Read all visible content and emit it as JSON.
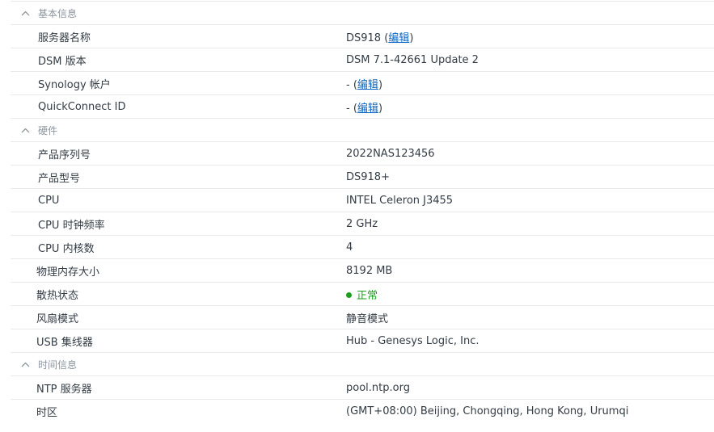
{
  "colors": {
    "link": "#0c66c2",
    "status_ok": "#1aa01a"
  },
  "sections": {
    "basic": {
      "title": "基本信息",
      "icon": "chevron-up-icon",
      "rows": {
        "server_name": {
          "label": "服务器名称",
          "value": "DS918",
          "edit": "编辑"
        },
        "dsm_version": {
          "label": "DSM 版本",
          "value": "DSM 7.1-42661 Update 2"
        },
        "synology_account": {
          "label": "Synology 帐户",
          "value": "-",
          "edit": "编辑"
        },
        "quickconnect": {
          "label": "QuickConnect ID",
          "value": "-",
          "edit": "编辑"
        }
      }
    },
    "hardware": {
      "title": "硬件",
      "icon": "chevron-up-icon",
      "rows": {
        "serial": {
          "label": "产品序列号",
          "value": "2022NAS123456"
        },
        "model": {
          "label": "产品型号",
          "value": "DS918+"
        },
        "cpu": {
          "label": "CPU",
          "value": "INTEL Celeron J3455"
        },
        "cpu_clock": {
          "label": "CPU 时钟频率",
          "value": "2 GHz"
        },
        "cpu_cores": {
          "label": "CPU 内核数",
          "value": "4"
        },
        "memory": {
          "label": "物理内存大小",
          "value": "8192 MB"
        },
        "thermal": {
          "label": "散热状态",
          "value": "正常",
          "status_icon": "status-dot-icon"
        },
        "fan_mode": {
          "label": "风扇模式",
          "value": "静音模式"
        },
        "usb_hub": {
          "label": "USB 集线器",
          "value": "Hub - Genesys Logic, Inc."
        }
      }
    },
    "time": {
      "title": "时间信息",
      "icon": "chevron-up-icon",
      "rows": {
        "ntp_server": {
          "label": "NTP 服务器",
          "value": "pool.ntp.org"
        },
        "timezone": {
          "label": "时区",
          "value": "(GMT+08:00) Beijing, Chongqing, Hong Kong, Urumqi"
        }
      }
    }
  }
}
